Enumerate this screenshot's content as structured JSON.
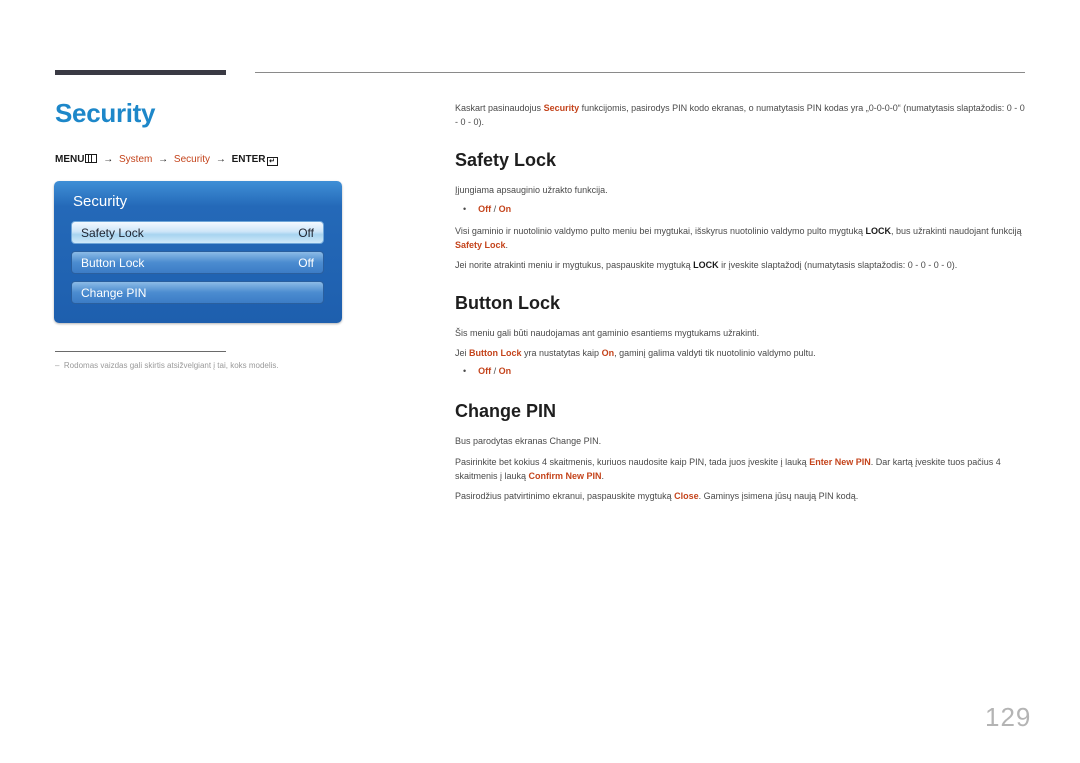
{
  "page": {
    "title": "Security",
    "page_number": "129"
  },
  "menu_path": {
    "menu": "MENU",
    "system": "System",
    "security": "Security",
    "enter": "ENTER",
    "arrow": "→",
    "enter_glyph": "↵"
  },
  "osd": {
    "title": "Security",
    "items": [
      {
        "label": "Safety Lock",
        "value": "Off",
        "selected": true
      },
      {
        "label": "Button Lock",
        "value": "Off",
        "selected": false
      },
      {
        "label": "Change PIN",
        "value": "",
        "selected": false
      }
    ]
  },
  "footnote": {
    "dash": "–",
    "text": "Rodomas vaizdas gali skirtis atsižvelgiant į tai, koks modelis."
  },
  "intro": {
    "pre": "Kaskart pasinaudojus ",
    "em": "Security",
    "post": " funkcijomis, pasirodys PIN kodo ekranas, o numatytasis PIN kodas yra „0-0-0-0“ (numatytasis slaptažodis: 0 - 0 - 0 - 0)."
  },
  "safety_lock": {
    "heading": "Safety Lock",
    "p1": "Įjungiama apsauginio užrakto funkcija.",
    "options": {
      "off": "Off",
      "sep": " / ",
      "on": "On"
    },
    "p2_pre": "Visi gaminio ir nuotolinio valdymo pulto meniu bei mygtukai, išskyrus nuotolinio valdymo pulto mygtuką ",
    "p2_key": "LOCK",
    "p2_mid": ", bus užrakinti naudojant funkciją ",
    "p2_em": "Safety Lock",
    "p2_post": ".",
    "p3_pre": "Jei norite atrakinti meniu ir mygtukus, paspauskite mygtuką ",
    "p3_key": "LOCK",
    "p3_post": " ir įveskite slaptažodį (numatytasis slaptažodis: 0 - 0 - 0 - 0)."
  },
  "button_lock": {
    "heading": "Button Lock",
    "p1": "Šis meniu gali būti naudojamas ant gaminio esantiems mygtukams užrakinti.",
    "p2_pre": "Jei ",
    "p2_em": "Button Lock",
    "p2_mid": " yra nustatytas kaip ",
    "p2_em2": "On",
    "p2_post": ", gaminį galima valdyti tik nuotolinio valdymo pultu.",
    "options": {
      "off": "Off",
      "sep": " / ",
      "on": "On"
    }
  },
  "change_pin": {
    "heading": "Change PIN",
    "p1": "Bus parodytas ekranas Change PIN.",
    "p2_pre": "Pasirinkite bet kokius 4 skaitmenis, kuriuos naudosite kaip PIN, tada juos įveskite į lauką ",
    "p2_em": "Enter New PIN",
    "p2_mid": ". Dar kartą įveskite tuos pačius 4 skaitmenis į lauką ",
    "p2_em2": "Confirm New PIN",
    "p2_post": ".",
    "p3_pre": "Pasirodžius patvirtinimo ekranui, paspauskite mygtuką ",
    "p3_em": "Close",
    "p3_post": ". Gaminys įsimena jūsų naują PIN kodą."
  },
  "colors": {
    "title_blue": "#1d87c9",
    "accent_orange": "#c4441c",
    "osd_blue": "#1e5fae"
  }
}
